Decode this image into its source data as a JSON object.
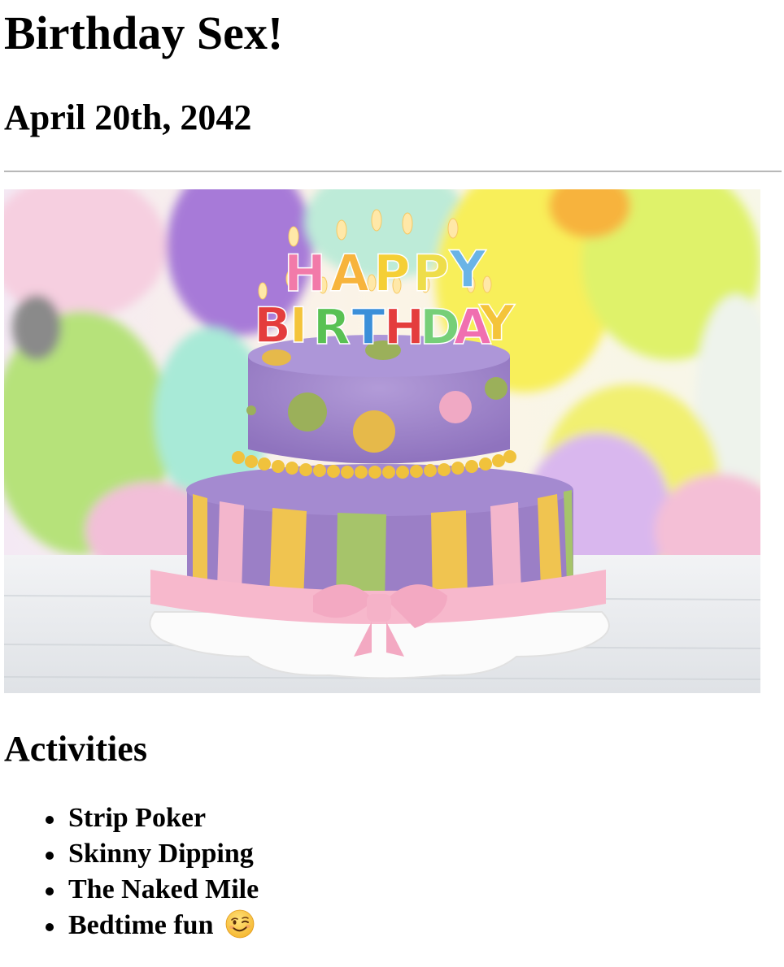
{
  "page": {
    "title": "Birthday Sex!",
    "date": "April 20th, 2042"
  },
  "image": {
    "alt": "Two-tier purple birthday cake with Happy Birthday candles in front of colorful balloons",
    "candles_top": [
      "H",
      "A",
      "P",
      "P",
      "Y"
    ],
    "candles_bottom": [
      "B",
      "I",
      "R",
      "T",
      "H",
      "D",
      "A",
      "Y"
    ]
  },
  "activities": {
    "heading": "Activities",
    "items": [
      {
        "label": "Strip Poker",
        "icon": null
      },
      {
        "label": "Skinny Dipping",
        "icon": null
      },
      {
        "label": "The Naked Mile",
        "icon": null
      },
      {
        "label": "Bedtime fun",
        "icon": "winking-face-emoji-icon"
      }
    ]
  },
  "colors": {
    "cake_purple": "#9b7fc6",
    "ribbon_yellow": "#f0c450",
    "ribbon_green": "#a6c46a",
    "ribbon_pink": "#f3b6cc",
    "board_pink": "#f7b8cc"
  }
}
